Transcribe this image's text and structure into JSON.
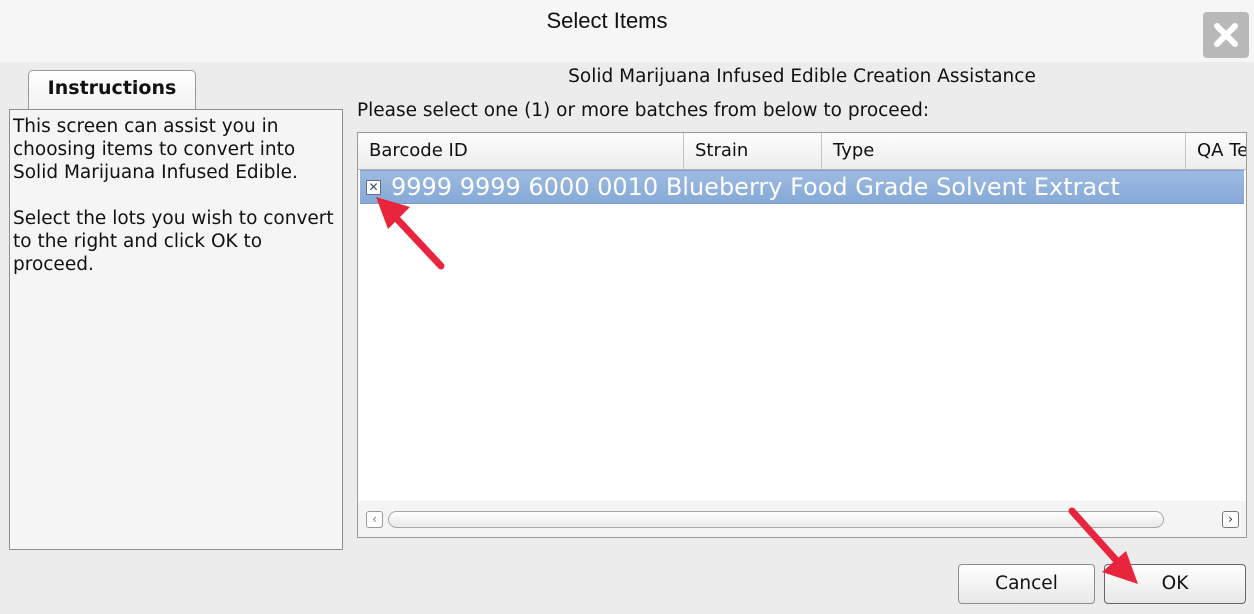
{
  "window": {
    "title": "Select Items",
    "close_icon": "close-icon"
  },
  "instructions": {
    "tab_label": "Instructions",
    "text": "This screen can assist you in choosing items to convert into Solid Marijuana Infused Edible.\n\nSelect the lots you wish to convert to the right and click OK to proceed."
  },
  "main": {
    "subtitle": "Solid Marijuana Infused Edible Creation Assistance",
    "prompt": "Please select one (1) or more batches from below to proceed:",
    "table": {
      "columns": [
        "Barcode ID",
        "Strain",
        "Type",
        "QA Te"
      ],
      "rows": [
        {
          "checked": true,
          "text": "9999 9999 6000 0010 Blueberry Food Grade Solvent Extract"
        }
      ]
    },
    "scroll_left_icon": "chevron-left-icon",
    "scroll_right_icon": "chevron-right-icon"
  },
  "buttons": {
    "cancel": "Cancel",
    "ok": "OK"
  },
  "annotations": {
    "arrow_color": "#e8253c"
  },
  "colors": {
    "selection": "#8fb0db",
    "dialog_bg": "#ececec"
  }
}
